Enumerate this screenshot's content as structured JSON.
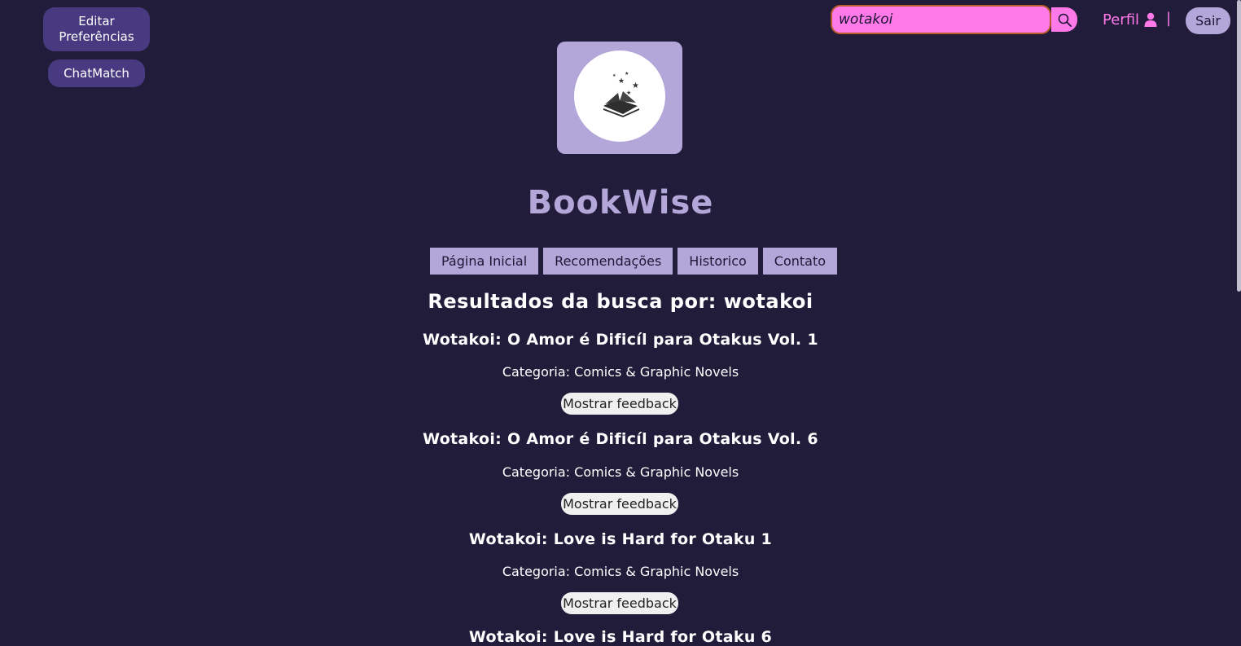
{
  "sidebar": {
    "edit_preferences": "Editar Preferências",
    "chatmatch": "ChatMatch"
  },
  "header": {
    "search_value": "wotakoi",
    "profile_label": "Perfil",
    "divider": "|",
    "logout_label": "Sair"
  },
  "brand": {
    "name": "BookWise"
  },
  "nav": {
    "items": [
      "Página Inicial",
      "Recomendações",
      "Historico",
      "Contato"
    ]
  },
  "results": {
    "heading": "Resultados da busca por: wotakoi",
    "feedback_label": "Mostrar feedback",
    "books": [
      {
        "title": "Wotakoi: O Amor é Dificíl para Otakus Vol. 1",
        "category": "Categoria: Comics & Graphic Novels"
      },
      {
        "title": "Wotakoi: O Amor é Dificíl para Otakus Vol. 6",
        "category": "Categoria: Comics & Graphic Novels"
      },
      {
        "title": "Wotakoi: Love is Hard for Otaku 1",
        "category": "Categoria: Comics & Graphic Novels"
      },
      {
        "title": "Wotakoi: Love is Hard for Otaku 6",
        "category": ""
      }
    ]
  },
  "icons": {
    "search": "search-icon",
    "profile": "user-icon",
    "logo": "book-stars-logo"
  },
  "colors": {
    "background": "#221c3b",
    "accent": "#b3a7d9",
    "pink": "#ff7ae8",
    "side_button": "#483a80"
  }
}
